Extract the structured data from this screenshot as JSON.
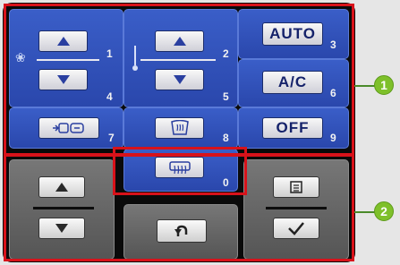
{
  "numbers": {
    "fan_up": "1",
    "fan_down": "4",
    "temp_up": "2",
    "temp_down": "5",
    "auto": "3",
    "ac": "6",
    "recirc": "7",
    "windshield": "8",
    "off": "9",
    "rear_defrost": "0"
  },
  "labels": {
    "auto": "AUTO",
    "ac": "A/C",
    "off": "OFF"
  },
  "callouts": {
    "first": "1",
    "second": "2"
  },
  "icons": {
    "fan": "fan-icon",
    "temp": "thermometer-icon",
    "recirc": "air-recirculation-icon",
    "windshield": "windshield-defrost-icon",
    "rear": "rear-defrost-icon",
    "up": "arrow-up-icon",
    "down": "arrow-down-icon",
    "back": "back-icon",
    "menu": "menu-icon",
    "ok": "checkmark-icon"
  },
  "colors": {
    "blue_key": "#2f50b8",
    "gray_key": "#666666",
    "frame": "#d8121a",
    "callout": "#7ec02a"
  }
}
